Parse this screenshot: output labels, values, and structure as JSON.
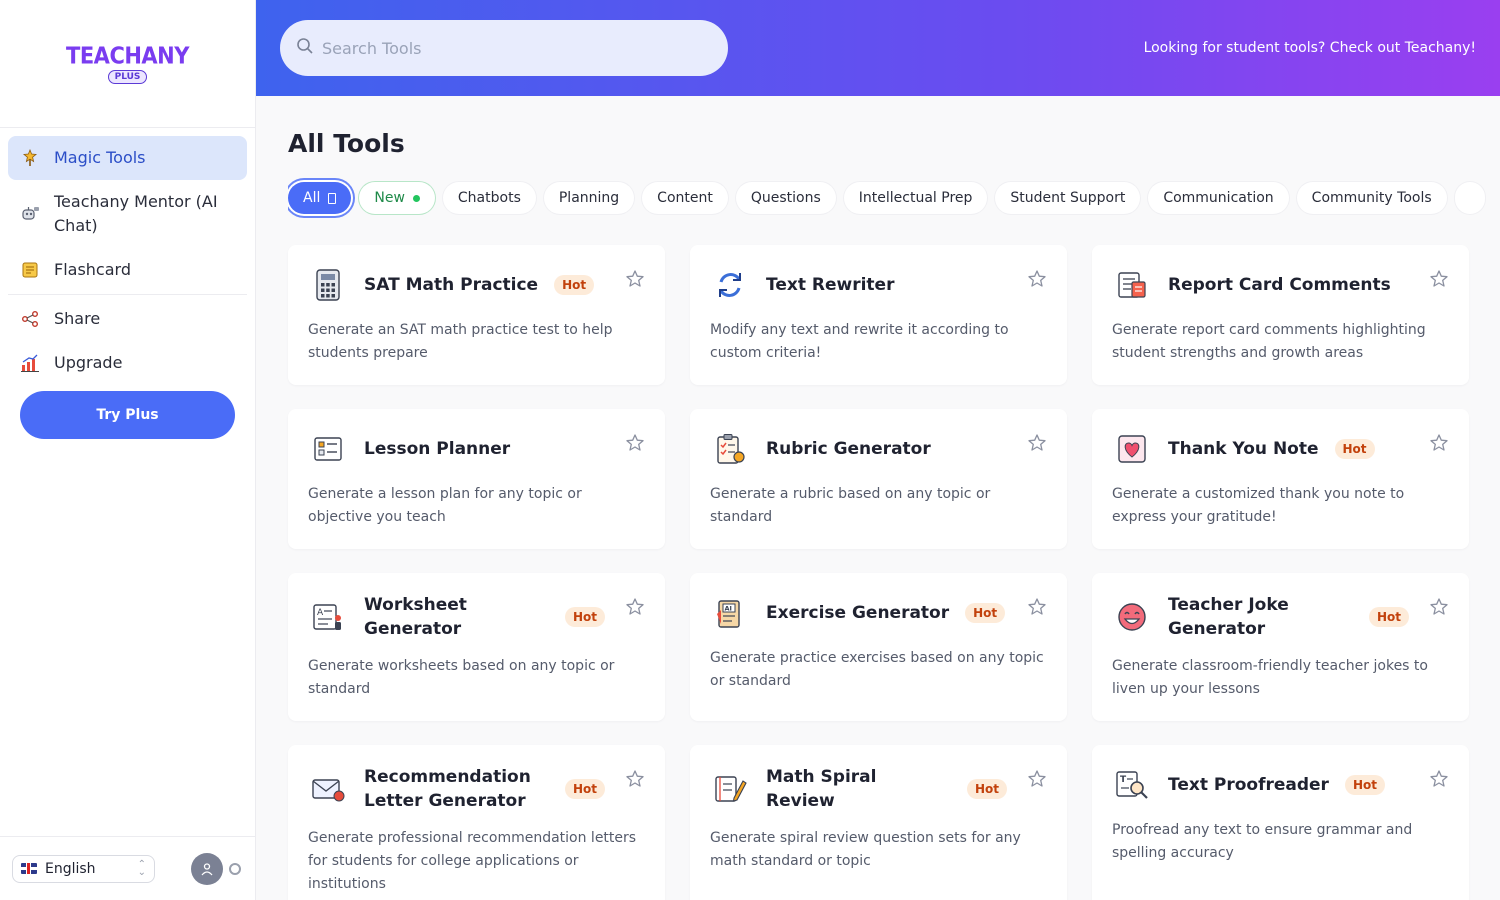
{
  "sidebar": {
    "logo_text": "TEACHANY",
    "logo_badge": "PLUS",
    "nav": [
      {
        "label": "Magic Tools",
        "icon": "magic-wand-icon",
        "active": true
      },
      {
        "label": "Teachany Mentor (AI Chat)",
        "icon": "robot-icon",
        "active": false
      },
      {
        "label": "Flashcard",
        "icon": "flashcard-icon",
        "active": false
      }
    ],
    "share_label": "Share",
    "upgrade_label": "Upgrade",
    "try_plus_label": "Try Plus",
    "language": "English"
  },
  "header": {
    "search_placeholder": "Search Tools",
    "promo": "Looking for student tools? Check out Teachany!"
  },
  "main": {
    "title": "All Tools",
    "chips": [
      {
        "label": "All",
        "kind": "all"
      },
      {
        "label": "New",
        "kind": "new"
      },
      {
        "label": "Chatbots",
        "kind": ""
      },
      {
        "label": "Planning",
        "kind": ""
      },
      {
        "label": "Content",
        "kind": ""
      },
      {
        "label": "Questions",
        "kind": ""
      },
      {
        "label": "Intellectual Prep",
        "kind": ""
      },
      {
        "label": "Student Support",
        "kind": ""
      },
      {
        "label": "Communication",
        "kind": ""
      },
      {
        "label": "Community Tools",
        "kind": ""
      }
    ],
    "hot_label": "Hot",
    "tools": [
      {
        "title": "SAT Math Practice",
        "hot": true,
        "icon": "calculator-icon",
        "desc": "Generate an SAT math practice test to help students prepare"
      },
      {
        "title": "Text Rewriter",
        "hot": false,
        "icon": "refresh-icon",
        "desc": "Modify any text and rewrite it according to custom criteria!"
      },
      {
        "title": "Report Card Comments",
        "hot": false,
        "icon": "report-card-icon",
        "desc": "Generate report card comments highlighting student strengths and growth areas"
      },
      {
        "title": "Lesson Planner",
        "hot": false,
        "icon": "lesson-plan-icon",
        "desc": "Generate a lesson plan for any topic or objective you teach"
      },
      {
        "title": "Rubric Generator",
        "hot": false,
        "icon": "clipboard-checklist-icon",
        "desc": "Generate a rubric based on any topic or standard"
      },
      {
        "title": "Thank You Note",
        "hot": true,
        "icon": "heart-card-icon",
        "desc": "Generate a customized thank you note to express your gratitude!"
      },
      {
        "title": "Worksheet Generator",
        "hot": true,
        "icon": "worksheet-icon",
        "desc": "Generate worksheets based on any topic or standard"
      },
      {
        "title": "Exercise Generator",
        "hot": true,
        "icon": "ai-clipboard-icon",
        "desc": "Generate practice exercises based on any topic or standard"
      },
      {
        "title": "Teacher Joke Generator",
        "hot": true,
        "icon": "laughing-face-icon",
        "desc": "Generate classroom-friendly teacher jokes to liven up your lessons"
      },
      {
        "title": "Recommendation Letter Generator",
        "hot": true,
        "icon": "letter-icon",
        "desc": "Generate professional recommendation letters for students for college applications or institutions"
      },
      {
        "title": "Math Spiral Review",
        "hot": true,
        "icon": "notebook-pencil-icon",
        "desc": "Generate spiral review question sets for any math standard or topic"
      },
      {
        "title": "Text Proofreader",
        "hot": true,
        "icon": "magnifier-text-icon",
        "desc": "Proofread any text to ensure grammar and spelling accuracy"
      }
    ]
  },
  "colors": {
    "accent": "#4a6cf7",
    "header_gradient_start": "#3e63ee",
    "header_gradient_end": "#9a3ff0",
    "hot_bg": "#fdebd9",
    "hot_text": "#c2410c"
  }
}
